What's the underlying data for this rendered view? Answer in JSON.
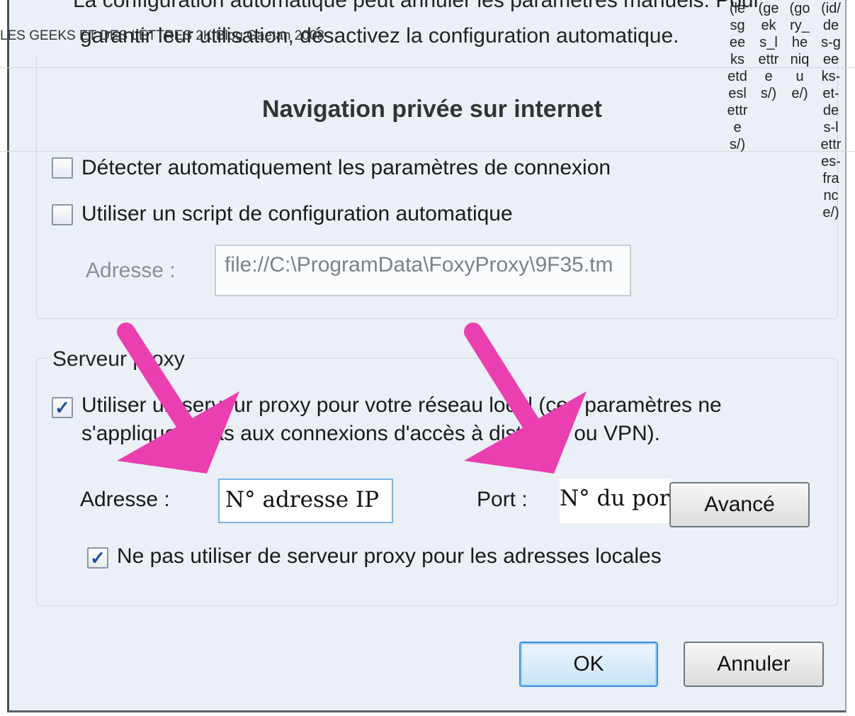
{
  "dialog": {
    "top_line": "La configuration automatique peut annuler les paramètres manuels. Pour",
    "line2": "garantir leur utilisation, désactivez la configuration automatique.",
    "auto_detect_label": "Détecter automatiquement les paramètres de connexion",
    "auto_script_label": "Utiliser un script de configuration automatique",
    "address_label": "Adresse :",
    "script_address_value": "file://C:\\ProgramData\\FoxyProxy\\9F35.tm",
    "proxy_group_title": "Serveur proxy",
    "use_proxy_label_line1": "Utiliser un serveur proxy pour votre réseau local (ces paramètres ne",
    "use_proxy_label_line2": "s'appliquent pas aux connexions d'accès à distance ou VPN).",
    "proxy_address_label": "Adresse :",
    "proxy_address_value": "N° adresse IP",
    "port_label": "Port :",
    "port_value": "N° du port",
    "advanced_button": "Avancé",
    "bypass_local_label": "Ne pas utiliser de serveur proxy pour les adresses locales",
    "ok_button": "OK",
    "cancel_button": "Annuler",
    "checked_mark": "✓"
  },
  "overlay": {
    "banner": "LES GEEKS ET DES LETTRES 2K Blog Gaetan 2008",
    "heading": "Navigation privée sur internet",
    "column1": "(lesgeeksetdeslettres/)",
    "column2": "(geeks_lettres/)",
    "column3": "(gory_henique/)",
    "column4": "(id/des-geeks-et-des-lettres-france/)"
  },
  "colors": {
    "arrow": "#ea3fb0",
    "window_bg": "#eaf0f6",
    "ok_border": "#3f8fd6"
  }
}
